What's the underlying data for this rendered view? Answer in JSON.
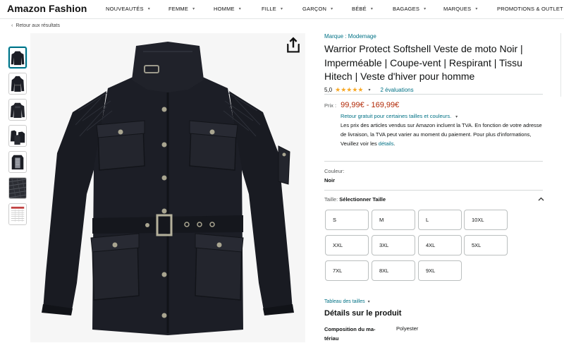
{
  "header": {
    "brand": "Amazon Fashion",
    "nav": [
      {
        "label": "NOUVEAUTÉS",
        "has_caret": true
      },
      {
        "label": "FEMME",
        "has_caret": true
      },
      {
        "label": "HOMME",
        "has_caret": true
      },
      {
        "label": "FILLE",
        "has_caret": true
      },
      {
        "label": "GARÇON",
        "has_caret": true
      },
      {
        "label": "BÉBÉ",
        "has_caret": true
      },
      {
        "label": "BAGAGES",
        "has_caret": true
      },
      {
        "label": "MARQUES",
        "has_caret": true
      },
      {
        "label": "PROMOTIONS & OUTLET",
        "has_caret": true
      }
    ]
  },
  "breadcrumb": {
    "back_label": "Retour aux résultats"
  },
  "gallery": {
    "thumbnails": [
      {
        "name": "jacket-front",
        "active": true
      },
      {
        "name": "jacket-side",
        "active": false
      },
      {
        "name": "jacket-back",
        "active": false
      },
      {
        "name": "jacket-views",
        "active": false
      },
      {
        "name": "jacket-lining",
        "active": false
      },
      {
        "name": "fabric-detail",
        "active": false
      },
      {
        "name": "size-chart",
        "active": false
      }
    ],
    "main_image": "black softshell motorcycle jacket"
  },
  "product": {
    "brand_link": "Marque : Modemage",
    "title": "Warrior Protect Softshell Veste de moto Noir | Imperméable | Coupe-vent | Respirant | Tissu Hitech | Veste d'hiver pour homme",
    "rating": "5,0",
    "stars": "★★★★★",
    "reviews": "2 évaluations",
    "price_label": "Prix :",
    "price": "99,99€ - 169,99€",
    "return_link": "Retour gratuit pour certaines tailles et couleurs.",
    "vat_text": "Les prix des articles vendus sur Amazon incluent la TVA. En fonction de votre adresse de livraison, la TVA peut varier au moment du paiement. Pour plus d'informations, Veuillez voir les ",
    "vat_link": "détails",
    "vat_end": ".",
    "color_label": "Couleur:",
    "color_value": "Noir",
    "size_label": "Taille:",
    "size_value": "Sélectionner Taille",
    "sizes": [
      "S",
      "M",
      "L",
      "10XL",
      "XXL",
      "3XL",
      "4XL",
      "5XL",
      "7XL",
      "8XL",
      "9XL"
    ],
    "size_chart_link": "Tableau des tailles",
    "details_title": "Détails sur le produit",
    "spec_key": "Composition du matériau",
    "spec_key_display": "Composition du ma-\ntériau",
    "spec_value": "Polyester"
  },
  "colors": {
    "link": "#007185",
    "price": "#b12704",
    "star": "#f7a825",
    "active_thumb_border": "#007185"
  }
}
